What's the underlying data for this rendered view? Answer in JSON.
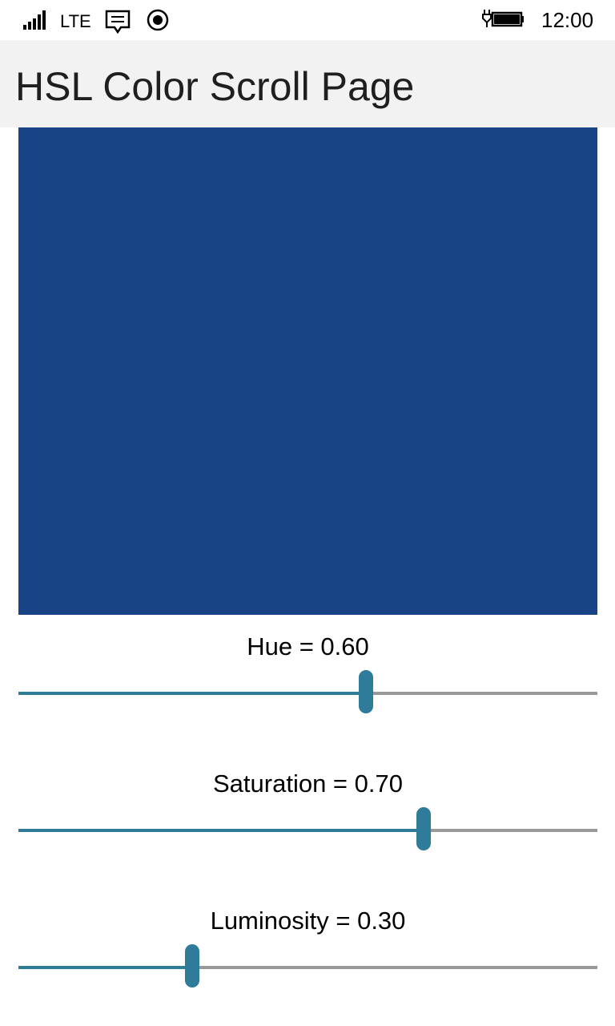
{
  "status_bar": {
    "network": "LTE",
    "time": "12:00",
    "icons": [
      "signal-icon",
      "message-icon",
      "record-icon",
      "battery-charging-icon"
    ]
  },
  "page": {
    "title": "HSL Color Scroll Page"
  },
  "swatch": {
    "color": "#184384"
  },
  "colors": {
    "accent": "#2e7c99",
    "track": "#999999"
  },
  "sliders": [
    {
      "label": "Hue = 0.60",
      "value": 0.6
    },
    {
      "label": "Saturation = 0.70",
      "value": 0.7
    },
    {
      "label": "Luminosity = 0.30",
      "value": 0.3
    }
  ]
}
